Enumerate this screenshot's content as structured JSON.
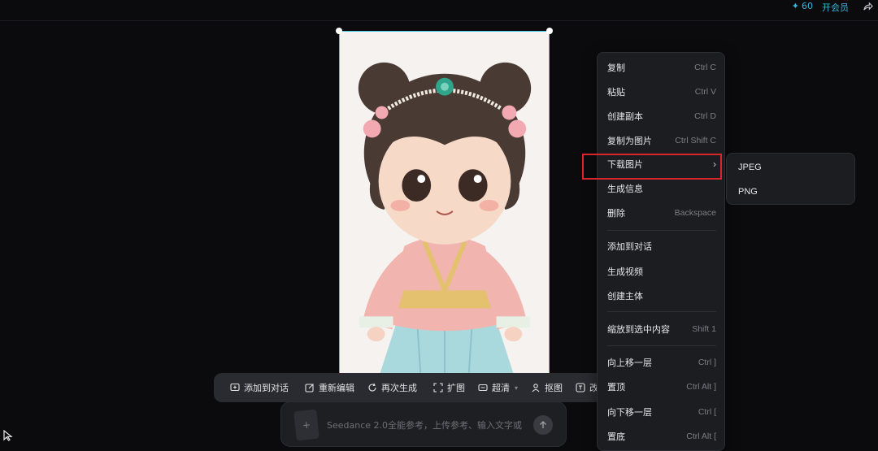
{
  "header": {
    "credits": "60",
    "vip_label": "开会员"
  },
  "toolbar": {
    "items": [
      {
        "label": "添加到对话",
        "icon": "add-chat-icon"
      },
      {
        "label": "重新编辑",
        "icon": "edit-icon"
      },
      {
        "label": "再次生成",
        "icon": "regenerate-icon"
      },
      {
        "label": "扩图",
        "icon": "expand-icon"
      },
      {
        "label": "超清",
        "icon": "hd-icon"
      },
      {
        "label": "抠图",
        "icon": "cutout-icon"
      },
      {
        "label": "改文",
        "icon": "text-icon"
      }
    ]
  },
  "prompt": {
    "placeholder": "Seedance 2.0全能参考，上传参考、输入文字或"
  },
  "context_menu": {
    "items": [
      {
        "label": "复制",
        "shortcut": "Ctrl C"
      },
      {
        "label": "粘贴",
        "shortcut": "Ctrl V"
      },
      {
        "label": "创建副本",
        "shortcut": "Ctrl D"
      },
      {
        "label": "复制为图片",
        "shortcut": "Ctrl Shift C"
      },
      {
        "label": "下载图片",
        "shortcut": ""
      },
      {
        "label": "生成信息",
        "shortcut": ""
      },
      {
        "label": "删除",
        "shortcut": "Backspace"
      },
      {
        "label": "添加到对话",
        "shortcut": ""
      },
      {
        "label": "生成视频",
        "shortcut": ""
      },
      {
        "label": "创建主体",
        "shortcut": ""
      },
      {
        "label": "缩放到选中内容",
        "shortcut": "Shift 1"
      },
      {
        "label": "向上移一层",
        "shortcut": "Ctrl ]"
      },
      {
        "label": "置顶",
        "shortcut": "Ctrl Alt ]"
      },
      {
        "label": "向下移一层",
        "shortcut": "Ctrl ["
      },
      {
        "label": "置底",
        "shortcut": "Ctrl Alt ["
      }
    ],
    "highlight_color": "#d8262a"
  },
  "submenu": {
    "items": [
      "JPEG",
      "PNG"
    ]
  },
  "colors": {
    "accent": "#35b7d9",
    "selection_border": "#45c6e6"
  }
}
